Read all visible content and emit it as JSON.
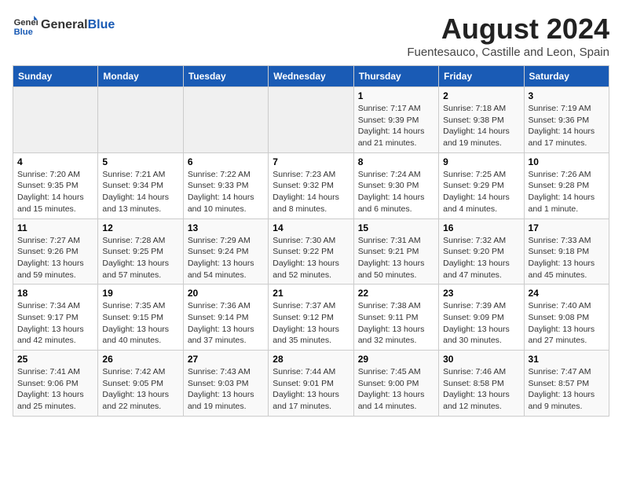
{
  "header": {
    "logo_general": "General",
    "logo_blue": "Blue",
    "month": "August 2024",
    "location": "Fuentesauco, Castille and Leon, Spain"
  },
  "weekdays": [
    "Sunday",
    "Monday",
    "Tuesday",
    "Wednesday",
    "Thursday",
    "Friday",
    "Saturday"
  ],
  "weeks": [
    [
      {
        "day": "",
        "content": ""
      },
      {
        "day": "",
        "content": ""
      },
      {
        "day": "",
        "content": ""
      },
      {
        "day": "",
        "content": ""
      },
      {
        "day": "1",
        "content": "Sunrise: 7:17 AM\nSunset: 9:39 PM\nDaylight: 14 hours\nand 21 minutes."
      },
      {
        "day": "2",
        "content": "Sunrise: 7:18 AM\nSunset: 9:38 PM\nDaylight: 14 hours\nand 19 minutes."
      },
      {
        "day": "3",
        "content": "Sunrise: 7:19 AM\nSunset: 9:36 PM\nDaylight: 14 hours\nand 17 minutes."
      }
    ],
    [
      {
        "day": "4",
        "content": "Sunrise: 7:20 AM\nSunset: 9:35 PM\nDaylight: 14 hours\nand 15 minutes."
      },
      {
        "day": "5",
        "content": "Sunrise: 7:21 AM\nSunset: 9:34 PM\nDaylight: 14 hours\nand 13 minutes."
      },
      {
        "day": "6",
        "content": "Sunrise: 7:22 AM\nSunset: 9:33 PM\nDaylight: 14 hours\nand 10 minutes."
      },
      {
        "day": "7",
        "content": "Sunrise: 7:23 AM\nSunset: 9:32 PM\nDaylight: 14 hours\nand 8 minutes."
      },
      {
        "day": "8",
        "content": "Sunrise: 7:24 AM\nSunset: 9:30 PM\nDaylight: 14 hours\nand 6 minutes."
      },
      {
        "day": "9",
        "content": "Sunrise: 7:25 AM\nSunset: 9:29 PM\nDaylight: 14 hours\nand 4 minutes."
      },
      {
        "day": "10",
        "content": "Sunrise: 7:26 AM\nSunset: 9:28 PM\nDaylight: 14 hours\nand 1 minute."
      }
    ],
    [
      {
        "day": "11",
        "content": "Sunrise: 7:27 AM\nSunset: 9:26 PM\nDaylight: 13 hours\nand 59 minutes."
      },
      {
        "day": "12",
        "content": "Sunrise: 7:28 AM\nSunset: 9:25 PM\nDaylight: 13 hours\nand 57 minutes."
      },
      {
        "day": "13",
        "content": "Sunrise: 7:29 AM\nSunset: 9:24 PM\nDaylight: 13 hours\nand 54 minutes."
      },
      {
        "day": "14",
        "content": "Sunrise: 7:30 AM\nSunset: 9:22 PM\nDaylight: 13 hours\nand 52 minutes."
      },
      {
        "day": "15",
        "content": "Sunrise: 7:31 AM\nSunset: 9:21 PM\nDaylight: 13 hours\nand 50 minutes."
      },
      {
        "day": "16",
        "content": "Sunrise: 7:32 AM\nSunset: 9:20 PM\nDaylight: 13 hours\nand 47 minutes."
      },
      {
        "day": "17",
        "content": "Sunrise: 7:33 AM\nSunset: 9:18 PM\nDaylight: 13 hours\nand 45 minutes."
      }
    ],
    [
      {
        "day": "18",
        "content": "Sunrise: 7:34 AM\nSunset: 9:17 PM\nDaylight: 13 hours\nand 42 minutes."
      },
      {
        "day": "19",
        "content": "Sunrise: 7:35 AM\nSunset: 9:15 PM\nDaylight: 13 hours\nand 40 minutes."
      },
      {
        "day": "20",
        "content": "Sunrise: 7:36 AM\nSunset: 9:14 PM\nDaylight: 13 hours\nand 37 minutes."
      },
      {
        "day": "21",
        "content": "Sunrise: 7:37 AM\nSunset: 9:12 PM\nDaylight: 13 hours\nand 35 minutes."
      },
      {
        "day": "22",
        "content": "Sunrise: 7:38 AM\nSunset: 9:11 PM\nDaylight: 13 hours\nand 32 minutes."
      },
      {
        "day": "23",
        "content": "Sunrise: 7:39 AM\nSunset: 9:09 PM\nDaylight: 13 hours\nand 30 minutes."
      },
      {
        "day": "24",
        "content": "Sunrise: 7:40 AM\nSunset: 9:08 PM\nDaylight: 13 hours\nand 27 minutes."
      }
    ],
    [
      {
        "day": "25",
        "content": "Sunrise: 7:41 AM\nSunset: 9:06 PM\nDaylight: 13 hours\nand 25 minutes."
      },
      {
        "day": "26",
        "content": "Sunrise: 7:42 AM\nSunset: 9:05 PM\nDaylight: 13 hours\nand 22 minutes."
      },
      {
        "day": "27",
        "content": "Sunrise: 7:43 AM\nSunset: 9:03 PM\nDaylight: 13 hours\nand 19 minutes."
      },
      {
        "day": "28",
        "content": "Sunrise: 7:44 AM\nSunset: 9:01 PM\nDaylight: 13 hours\nand 17 minutes."
      },
      {
        "day": "29",
        "content": "Sunrise: 7:45 AM\nSunset: 9:00 PM\nDaylight: 13 hours\nand 14 minutes."
      },
      {
        "day": "30",
        "content": "Sunrise: 7:46 AM\nSunset: 8:58 PM\nDaylight: 13 hours\nand 12 minutes."
      },
      {
        "day": "31",
        "content": "Sunrise: 7:47 AM\nSunset: 8:57 PM\nDaylight: 13 hours\nand 9 minutes."
      }
    ]
  ]
}
